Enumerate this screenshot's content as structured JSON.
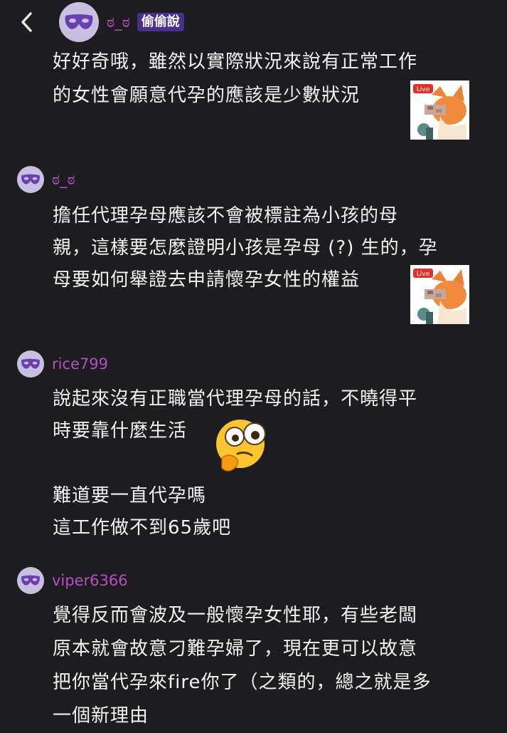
{
  "header": {
    "back_icon": "chevron-left-icon",
    "author": "ಠ_ಠ",
    "badge": "偷偷說",
    "post_lines": [
      "好好奇哦，雖然以實際狀況來說有正常工作",
      "的女性會願意代孕的應該是少數狀況"
    ],
    "sticker": "live-fox-sticker"
  },
  "comments": [
    {
      "author": "ಠ_ಠ",
      "lines": [
        "擔任代理孕母應該不會被標註為小孩的母",
        "親，這樣要怎麼證明小孩是孕母 (?) 生的，孕",
        "母要如何舉證去申請懷孕女性的權益"
      ],
      "sticker": "live-fox-sticker"
    },
    {
      "author": "rice799",
      "lines": [
        "說起來沒有正職當代理孕母的話，不曉得平",
        "時要靠什麼生活"
      ],
      "emoji": "thinking-face-emoji",
      "lines2": [
        "難道要一直代孕嗎",
        "這工作做不到65歲吧"
      ]
    },
    {
      "author": "viper6366",
      "lines": [
        "覺得反而會波及一般懷孕女性耶，有些老闆",
        "原本就會故意刁難孕婦了，現在更可以故意",
        "把你當代孕來fire你了（之類的，總之就是多",
        "一個新理由"
      ]
    }
  ],
  "colors": {
    "background": "#1d1c1f",
    "username": "#b44fc4",
    "badge_bg": "#4b2f8f",
    "avatar_bg": "#c9bfe0",
    "mask": "#6a3fb0"
  }
}
